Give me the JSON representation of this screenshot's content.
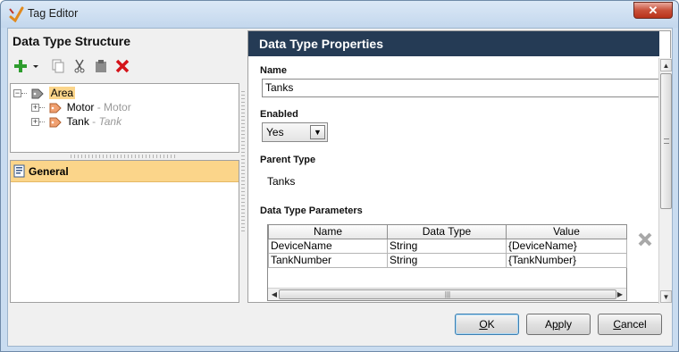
{
  "window": {
    "title": "Tag Editor",
    "close_label": "✕"
  },
  "left": {
    "title": "Data Type Structure",
    "tree": {
      "root": {
        "label": "Area"
      },
      "children": [
        {
          "name": "Motor",
          "sep": " - ",
          "type": "Motor"
        },
        {
          "name": "Tank",
          "sep": " - ",
          "type": "Tank"
        }
      ]
    },
    "sections": [
      {
        "label": "General"
      }
    ]
  },
  "right": {
    "header": "Data Type Properties",
    "name_label": "Name",
    "name_value": "Tanks",
    "enabled_label": "Enabled",
    "enabled_value": "Yes",
    "parent_type_label": "Parent Type",
    "parent_type_value": "Tanks",
    "params_label": "Data Type Parameters",
    "params_columns": [
      "Name",
      "Data Type",
      "Value"
    ],
    "params_rows": [
      [
        "DeviceName",
        "String",
        "{DeviceName}"
      ],
      [
        "TankNumber",
        "String",
        "{TankNumber}"
      ]
    ]
  },
  "buttons": {
    "ok": {
      "label": "OK",
      "mnemonic": "O",
      "rest": "K"
    },
    "apply": {
      "label": "Apply",
      "pre": "A",
      "mnemonic": "p",
      "rest": "ply"
    },
    "cancel": {
      "label": "Cancel",
      "pre": "",
      "mnemonic": "C",
      "rest": "ancel"
    }
  },
  "colors": {
    "header_bg": "#253b55",
    "selection": "#fbd58a",
    "delete_red": "#d4141a",
    "add_green": "#2e9d2e"
  },
  "icons": [
    "tag-editor-icon",
    "add-icon",
    "dropdown-arrow-icon",
    "copy-icon",
    "cut-icon",
    "paste-icon",
    "delete-icon",
    "tag-icon",
    "general-section-icon",
    "remove-parameter-icon"
  ]
}
